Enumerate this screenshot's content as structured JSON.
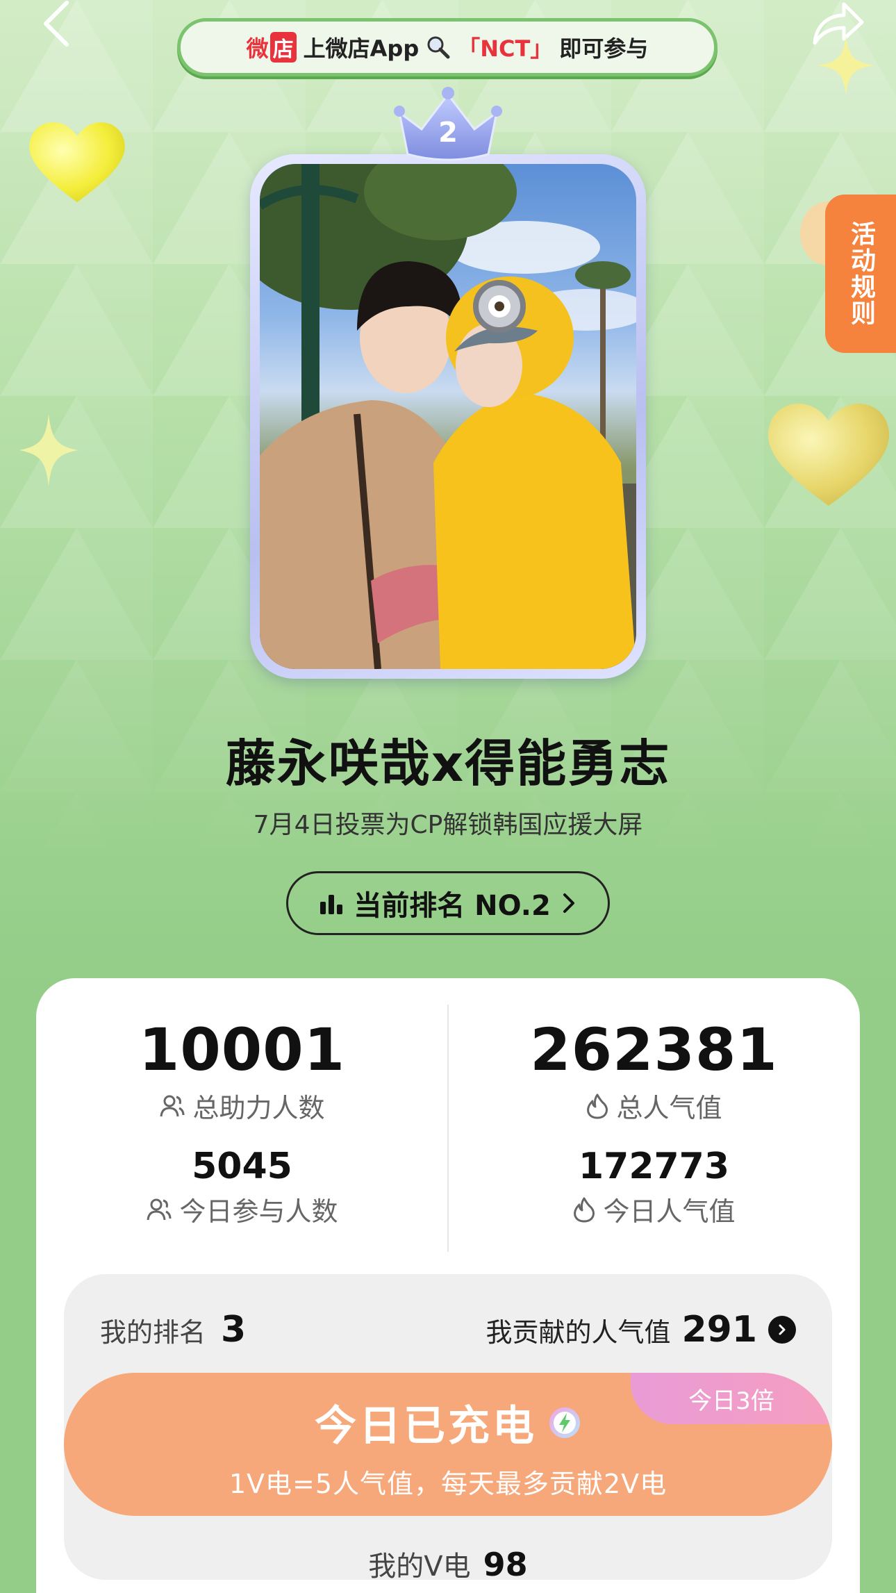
{
  "banner": {
    "logo_text": "微",
    "logo_box": "店",
    "text_prefix": "上微店App",
    "keyword": "「NCT」",
    "text_suffix": "即可参与"
  },
  "rules_tab": {
    "label": "活动规则"
  },
  "crown": {
    "rank": "2"
  },
  "cp": {
    "title": "藤永咲哉x得能勇志",
    "subtitle": "7月4日投票为CP解锁韩国应援大屏"
  },
  "rank_pill": {
    "label": "当前排名 NO.2"
  },
  "stats": {
    "total_supporters": {
      "value": "10001",
      "label": "总助力人数"
    },
    "total_popularity": {
      "value": "262381",
      "label": "总人气值"
    },
    "today_participants": {
      "value": "5045",
      "label": "今日参与人数"
    },
    "today_popularity": {
      "value": "172773",
      "label": "今日人气值"
    }
  },
  "my": {
    "rank_label": "我的排名",
    "rank_value": "3",
    "contrib_label": "我贡献的人气值",
    "contrib_value": "291",
    "charge_title": "今日已充电",
    "charge_sub": "1V电=5人气值，每天最多贡献2V电",
    "triple_tag": "今日3倍",
    "v_label": "我的V电",
    "v_value": "98"
  },
  "colors": {
    "background": "#93cd88",
    "charge": "#f7a87a",
    "rules_tab": "#f5823d",
    "keyword": "#e8323c"
  }
}
